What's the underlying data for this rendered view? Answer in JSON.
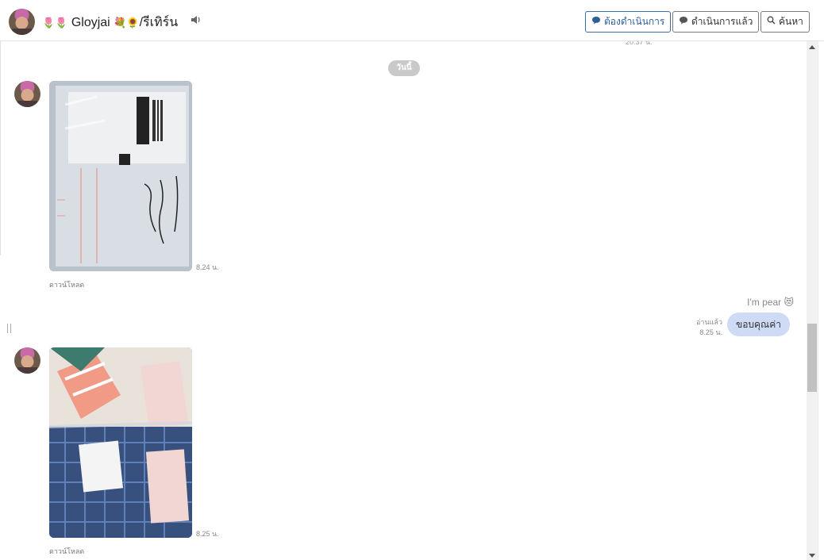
{
  "header": {
    "name_pre_emoji": "🌷🌷",
    "name": "Gloyjai",
    "name_post_emoji": "💐🌻",
    "name_suffix": "/รีเทิร์น",
    "speaker_icon": "speaker-icon",
    "buttons": {
      "todo": "ต้องดำเนินการ",
      "done": "ดำเนินการแล้ว",
      "search": "ค้นหา"
    }
  },
  "chat": {
    "cut_time": "20.37 น.",
    "day_chip": "วันนี้",
    "messages": [
      {
        "type": "image",
        "time": "8.24 น.",
        "download": "ดาวน์โหลด"
      },
      {
        "type": "text",
        "sender": "I'm pear",
        "sender_emoji": "😻",
        "read": "อ่านแล้ว",
        "time": "8.25 น.",
        "text": "ขอบคุณค่า"
      },
      {
        "type": "image",
        "time": "8.25 น.",
        "download": "ดาวน์โหลด"
      }
    ]
  },
  "colors": {
    "bubble": "#cfdaf5",
    "accent_button": "#2d5f99",
    "day_chip": "#c9c9c9"
  }
}
